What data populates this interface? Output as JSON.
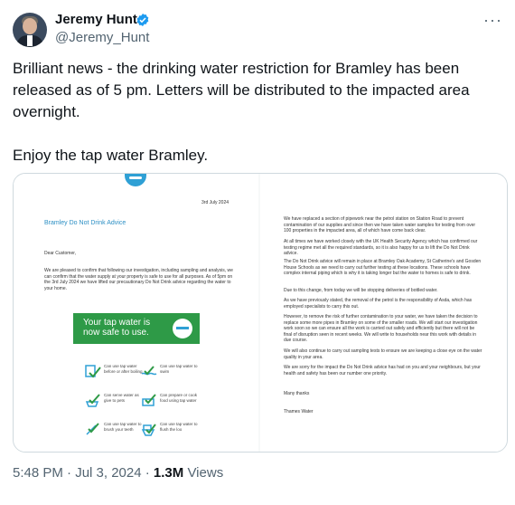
{
  "author": {
    "name": "Jeremy Hunt",
    "handle": "@Jeremy_Hunt"
  },
  "more_menu_label": "···",
  "tweet": {
    "paragraph_1": "Brilliant news - the drinking water restriction for Bramley has been released as of 5 pm. Letters will be distributed to the impacted area overnight.",
    "paragraph_2": "Enjoy the tap water Bramley."
  },
  "letter_left": {
    "date": "3rd July 2024",
    "title": "Bramley Do Not Drink Advice",
    "salutation": "Dear Customer,",
    "paragraph": "We are pleased to confirm that following our investigation, including sampling and analysis, we can confirm that the water supply at your property is safe to use for all purposes. As of 5pm on the 3rd July 2024 we have lifted our precautionary Do Not Drink advice regarding the water to your home.",
    "banner_text": "Your tap water is now safe to use.",
    "icons": [
      {
        "label": "Can use tap water before or after boiling"
      },
      {
        "label": "Can use tap water to swim"
      },
      {
        "label": "Can serve water as give to pets"
      },
      {
        "label": "Can prepare or cook food using tap water"
      },
      {
        "label": "Can use tap water to brush your teeth"
      },
      {
        "label": "Can use tap water to flush the loo"
      }
    ]
  },
  "letter_right": {
    "paragraphs": [
      "We have replaced a section of pipework near the petrol station on Station Road to prevent contamination of our supplies and since then we have taken water samples for testing from over 100 properties in the impacted area, all of which have come back clear.",
      "At all times we have worked closely with the UK Health Security Agency which has confirmed our testing regime met all the required standards, so it is also happy for us to lift the Do Not Drink advice.",
      "The Do Not Drink advice will remain in place at Bramley Oak Academy, St Catherine's and Gosden House Schools as we need to carry out further testing at these locations. These schools have complex internal piping which is why it is taking longer but the water to homes is safe to drink.",
      "Due to this change, from today we will be stopping deliveries of bottled water.",
      "As we have previously stated, the removal of the petrol is the responsibility of Asda, which has employed specialists to carry this out.",
      "However, to remove the risk of further contamination to your water, we have taken the decision to replace some more pipes in Bramley on some of the smaller roads. We will start our investigation work soon so we can ensure all the work is carried out safely and efficiently but there will not be final of disruption seen in recent weeks. We will write to households near this work with details in due course.",
      "We will also continue to carry out sampling tests to ensure we are keeping a close eye on the water quality in your area.",
      "We are sorry for the impact the Do Not Drink advice has had on you and your neighbours, but your health and safety has been our number one priority.",
      "Many thanks",
      "Thames Water"
    ]
  },
  "footer": {
    "timestamp": "5:48 PM · Jul 3, 2024 · ",
    "views_count": "1.3M",
    "views_label": " Views"
  },
  "colors": {
    "verified": "#1d9bf0",
    "banner": "#2e9a47",
    "letter_title": "#2c8fc4"
  }
}
